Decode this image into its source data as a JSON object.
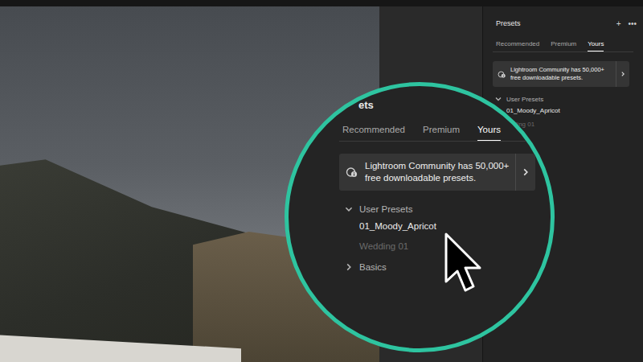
{
  "panel": {
    "title": "Presets",
    "add_button": "+",
    "more_button": "•••",
    "tabs": [
      {
        "label": "Recommended",
        "selected": false
      },
      {
        "label": "Premium",
        "selected": false
      },
      {
        "label": "Yours",
        "selected": true
      }
    ],
    "banner": {
      "lines": [
        "Lightroom Community has 50,000+",
        "free downloadable presets."
      ]
    },
    "groups": [
      {
        "label": "User Presets",
        "expanded": true,
        "items": [
          {
            "label": "01_Moody_Apricot",
            "disabled": false
          },
          {
            "label": "edding 01",
            "disabled": true
          }
        ]
      }
    ]
  },
  "magnifier": {
    "title": "ets",
    "tabs": [
      {
        "label": "Recommended",
        "selected": false
      },
      {
        "label": "Premium",
        "selected": false
      },
      {
        "label": "Yours",
        "selected": true
      }
    ],
    "banner": {
      "lines": [
        "Lightroom Community has 50,000+",
        "free downloadable presets."
      ]
    },
    "groups": [
      {
        "label": "User Presets",
        "expanded": true,
        "items": [
          {
            "label": "01_Moody_Apricot",
            "disabled": false
          },
          {
            "label": "Wedding 01",
            "disabled": true
          }
        ]
      },
      {
        "label": "Basics",
        "expanded": false,
        "items": []
      }
    ]
  }
}
